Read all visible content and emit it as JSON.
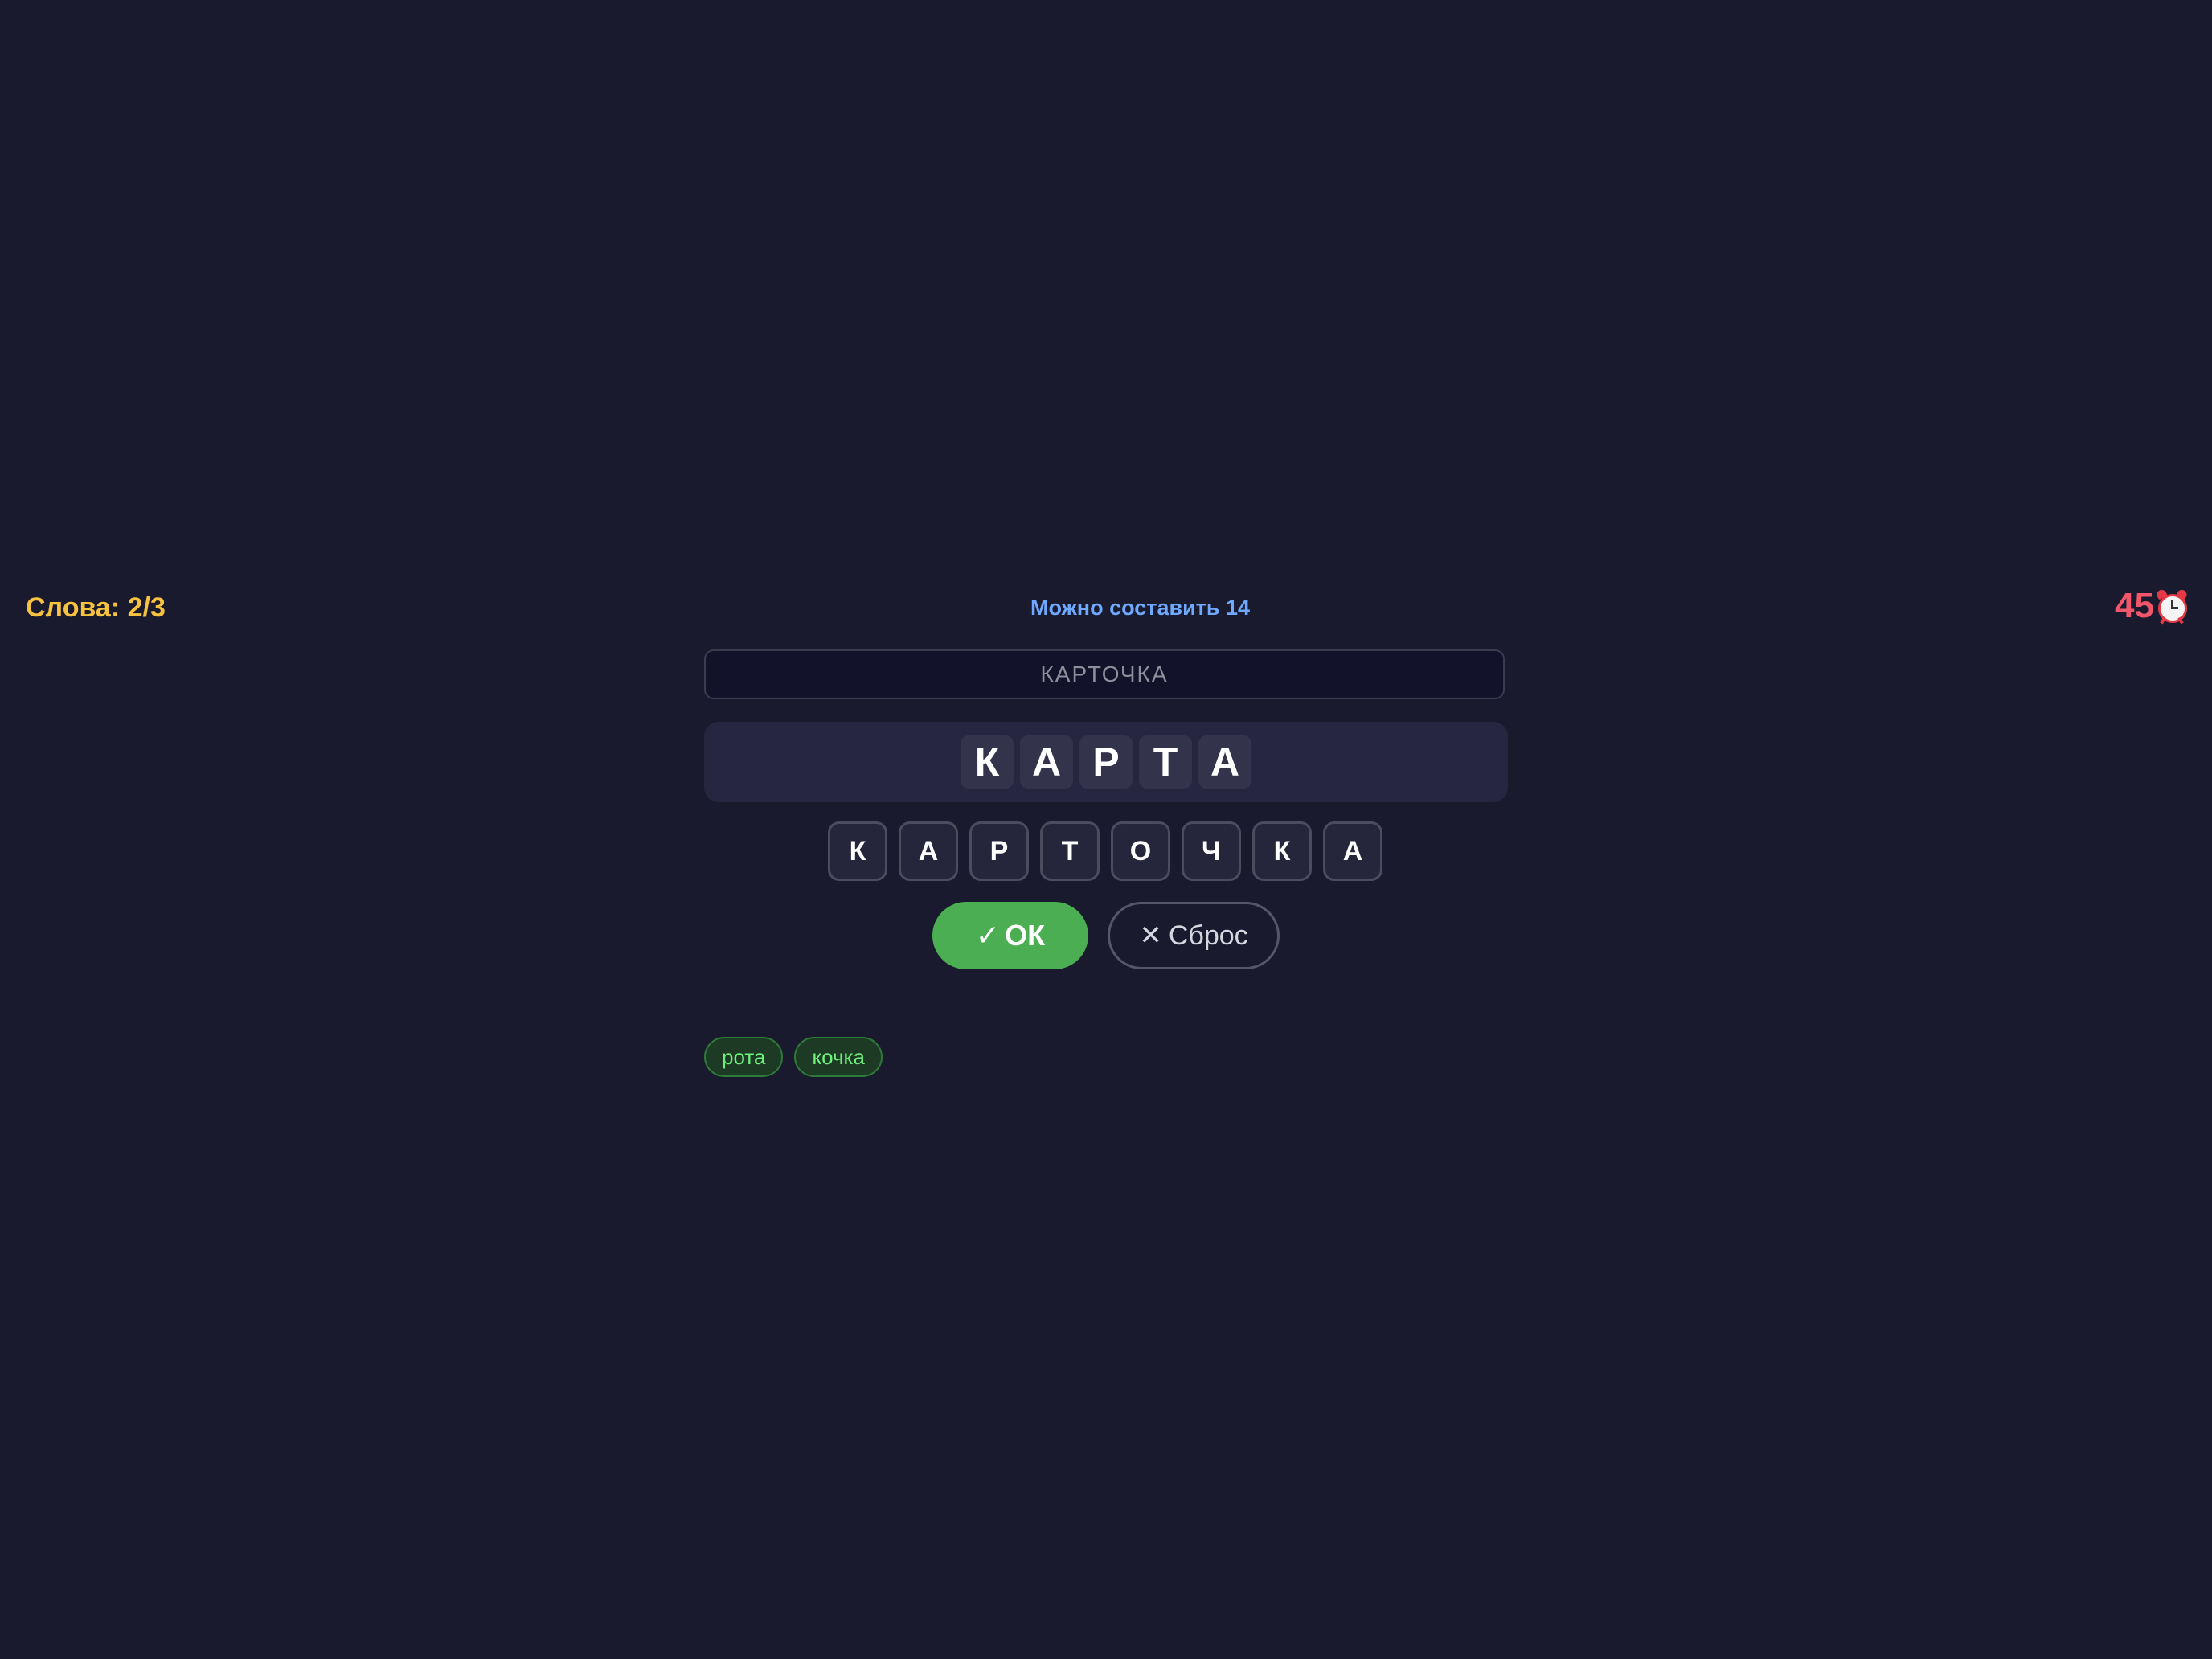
{
  "status": {
    "words_label": "Слова: 2/3",
    "possible_label": "Можно составить 14",
    "timer_value": "45",
    "timer_icon": "alarm-clock-icon"
  },
  "source_word": "КАРТОЧКА",
  "answer_letters": [
    "К",
    "А",
    "Р",
    "Т",
    "А"
  ],
  "letter_buttons": [
    "К",
    "А",
    "Р",
    "Т",
    "О",
    "Ч",
    "К",
    "А"
  ],
  "buttons": {
    "ok_icon": "✓",
    "ok_label": "ОК",
    "reset_icon": "✕",
    "reset_label": "Сброс"
  },
  "found_words": [
    "рота",
    "кочка"
  ],
  "colors": {
    "background": "#191a2d",
    "words_counter": "#f7c23e",
    "possible_count": "#6fa8ff",
    "timer": "#f2566a",
    "ok_button": "#4cae52",
    "found_word_text": "#6ef07c"
  }
}
